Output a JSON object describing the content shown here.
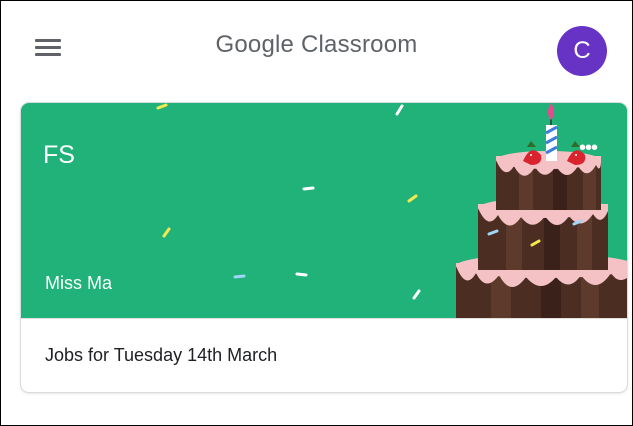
{
  "header": {
    "title": "Google Classroom",
    "menu_icon": "hamburger-menu-icon",
    "avatar_letter": "C",
    "avatar_color": "#6733c4"
  },
  "class_card": {
    "name": "FS",
    "teacher": "Miss Ma",
    "banner_color": "#21b27a",
    "banner_theme": "birthday-cake",
    "more_icon": "more-options-icon",
    "upcoming": "Jobs for Tuesday 14th March"
  }
}
